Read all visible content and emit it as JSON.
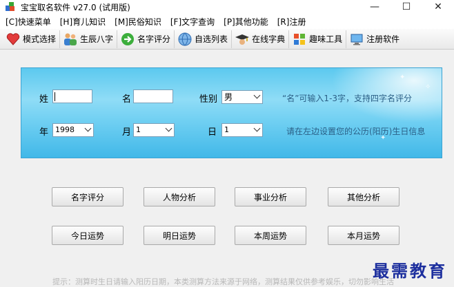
{
  "window": {
    "title": "宝宝取名软件 v27.0 (试用版)",
    "minimize": "—",
    "maximize": "☐",
    "close": "✕"
  },
  "menu": [
    "[C]快速菜单",
    "[H]育儿知识",
    "[M]民俗知识",
    "[F]文字查询",
    "[P]其他功能",
    "[R]注册"
  ],
  "toolbar": [
    {
      "label": "模式选择",
      "icon": "heart-icon"
    },
    {
      "label": "生辰八字",
      "icon": "people-icon"
    },
    {
      "label": "名字评分",
      "icon": "arrow-right-icon"
    },
    {
      "label": "自选列表",
      "icon": "globe-icon"
    },
    {
      "label": "在线字典",
      "icon": "graduation-cap-icon"
    },
    {
      "label": "趣味工具",
      "icon": "windows-logo-icon"
    },
    {
      "label": "注册软件",
      "icon": "monitor-icon"
    }
  ],
  "form": {
    "surname_label": "姓",
    "given_label": "名",
    "gender_label": "性别",
    "gender_value": "男",
    "name_hint": "“名”可输入1-3字，支持四字名评分",
    "year_label": "年",
    "year_value": "1998",
    "month_label": "月",
    "month_value": "1",
    "day_label": "日",
    "day_value": "1",
    "date_hint": "请在左边设置您的公历(阳历)生日信息"
  },
  "buttons": {
    "row1": [
      "名字评分",
      "人物分析",
      "事业分析",
      "其他分析"
    ],
    "row2": [
      "今日运势",
      "明日运势",
      "本周运势",
      "本月运势"
    ]
  },
  "footer_tip": "提示：测算时生日请输入阳历日期，本类测算方法来源于网络，测算结果仅供参考娱乐，切勿影响生活",
  "watermark": "最需教育",
  "colors": {
    "panel_blue": "#6fcff2",
    "watermark": "#1d2f9e"
  }
}
